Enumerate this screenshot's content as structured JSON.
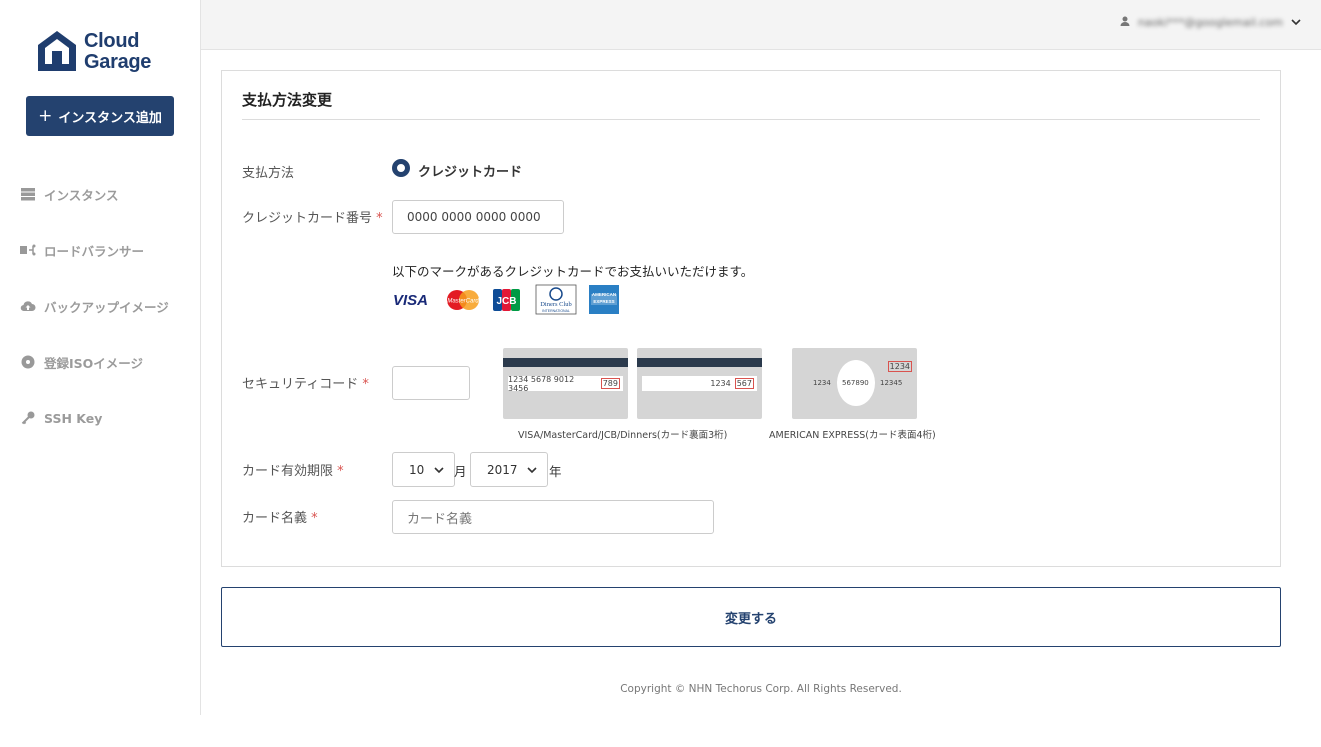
{
  "brand": {
    "line1": "Cloud",
    "line2": "Garage"
  },
  "sidebar": {
    "add_button": "インスタンス追加",
    "items": [
      {
        "label": "インスタンス",
        "icon": "server-icon"
      },
      {
        "label": "ロードバランサー",
        "icon": "load-balancer-icon"
      },
      {
        "label": "バックアップイメージ",
        "icon": "cloud-upload-icon"
      },
      {
        "label": "登録ISOイメージ",
        "icon": "disc-icon"
      },
      {
        "label": "SSH Key",
        "icon": "key-icon"
      }
    ]
  },
  "header": {
    "user_email": "naoki***@googlemail.com"
  },
  "form": {
    "title": "支払方法変更",
    "payment_method_label": "支払方法",
    "payment_method_option": "クレジットカード",
    "card_number_label": "クレジットカード番号",
    "card_number_placeholder": "0000 0000 0000 0000",
    "accepted_note": "以下のマークがあるクレジットカードでお支払いいただけます。",
    "brands": [
      "VISA",
      "MasterCard",
      "JCB",
      "Diners Club",
      "AMERICAN EXPRESS"
    ],
    "security_code_label": "セキュリティコード",
    "card_back_1": {
      "number": "1234  5678  9012  3456",
      "code": "789"
    },
    "card_back_2": {
      "number": "1234",
      "code": "567"
    },
    "card_front_amex": {
      "code": "1234",
      "left": "1234",
      "mid": "567890",
      "right": "12345"
    },
    "caption_back": "VISA/MasterCard/JCB/Dinners(カード裏面3桁)",
    "caption_front": "AMERICAN EXPRESS(カード表面4桁)",
    "expiry_label": "カード有効期限",
    "expiry_month": "10",
    "month_unit": "月",
    "expiry_year": "2017",
    "year_unit": "年",
    "name_label": "カード名義",
    "name_placeholder": "カード名義",
    "required_mark": "*"
  },
  "submit_label": "変更する",
  "footer": "Copyright © NHN Techorus Corp. All Rights Reserved.",
  "colors": {
    "primary": "#24426f",
    "required": "#d9534f",
    "nav_text": "#9b9b9b"
  }
}
